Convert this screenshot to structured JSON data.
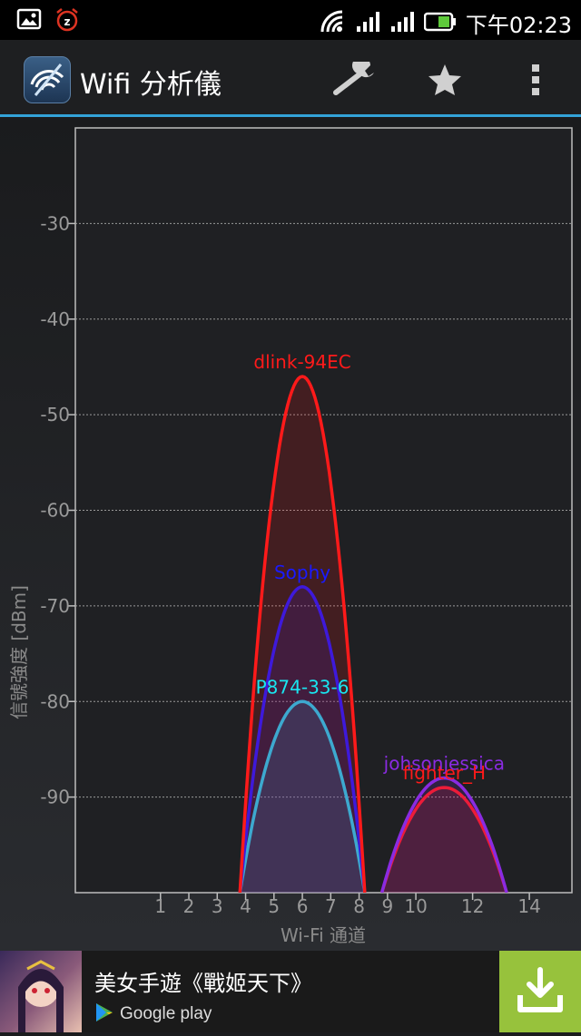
{
  "status_bar": {
    "time": "下午02:23",
    "icons": [
      "image-icon",
      "alarm-icon",
      "wifi-signal-icon",
      "cell-signal-icon",
      "cell-signal-icon",
      "battery-icon"
    ]
  },
  "app_bar": {
    "title": "Wifi 分析儀",
    "actions": [
      "wrench-icon",
      "star-icon",
      "overflow-menu-icon"
    ]
  },
  "chart_data": {
    "type": "area",
    "xlabel": "Wi-Fi 通道",
    "ylabel": "信號強度 [dBm]",
    "x_ticks": [
      1,
      2,
      3,
      4,
      5,
      6,
      7,
      8,
      9,
      10,
      12,
      14
    ],
    "y_ticks": [
      -30,
      -40,
      -50,
      -60,
      -70,
      -80,
      -90
    ],
    "xlim": [
      -2,
      15.5
    ],
    "ylim": [
      -100,
      -20
    ],
    "grid": true,
    "series": [
      {
        "name": "dlink-94EC",
        "channel": 6,
        "signal_dbm": -46,
        "color": "#ff1a1a"
      },
      {
        "name": "Sophy",
        "channel": 6,
        "signal_dbm": -68,
        "color": "#1a1aff"
      },
      {
        "name": "P874-33-6",
        "channel": 6,
        "signal_dbm": -80,
        "color": "#19e6f0"
      },
      {
        "name": "johsonjessica",
        "channel": 11,
        "signal_dbm": -88,
        "color": "#8a2be2"
      },
      {
        "name": "fighter_H",
        "channel": 11,
        "signal_dbm": -89,
        "color": "#ff1a1a"
      }
    ]
  },
  "ad": {
    "title": "美女手遊《戰姬天下》",
    "store": "Google play"
  }
}
